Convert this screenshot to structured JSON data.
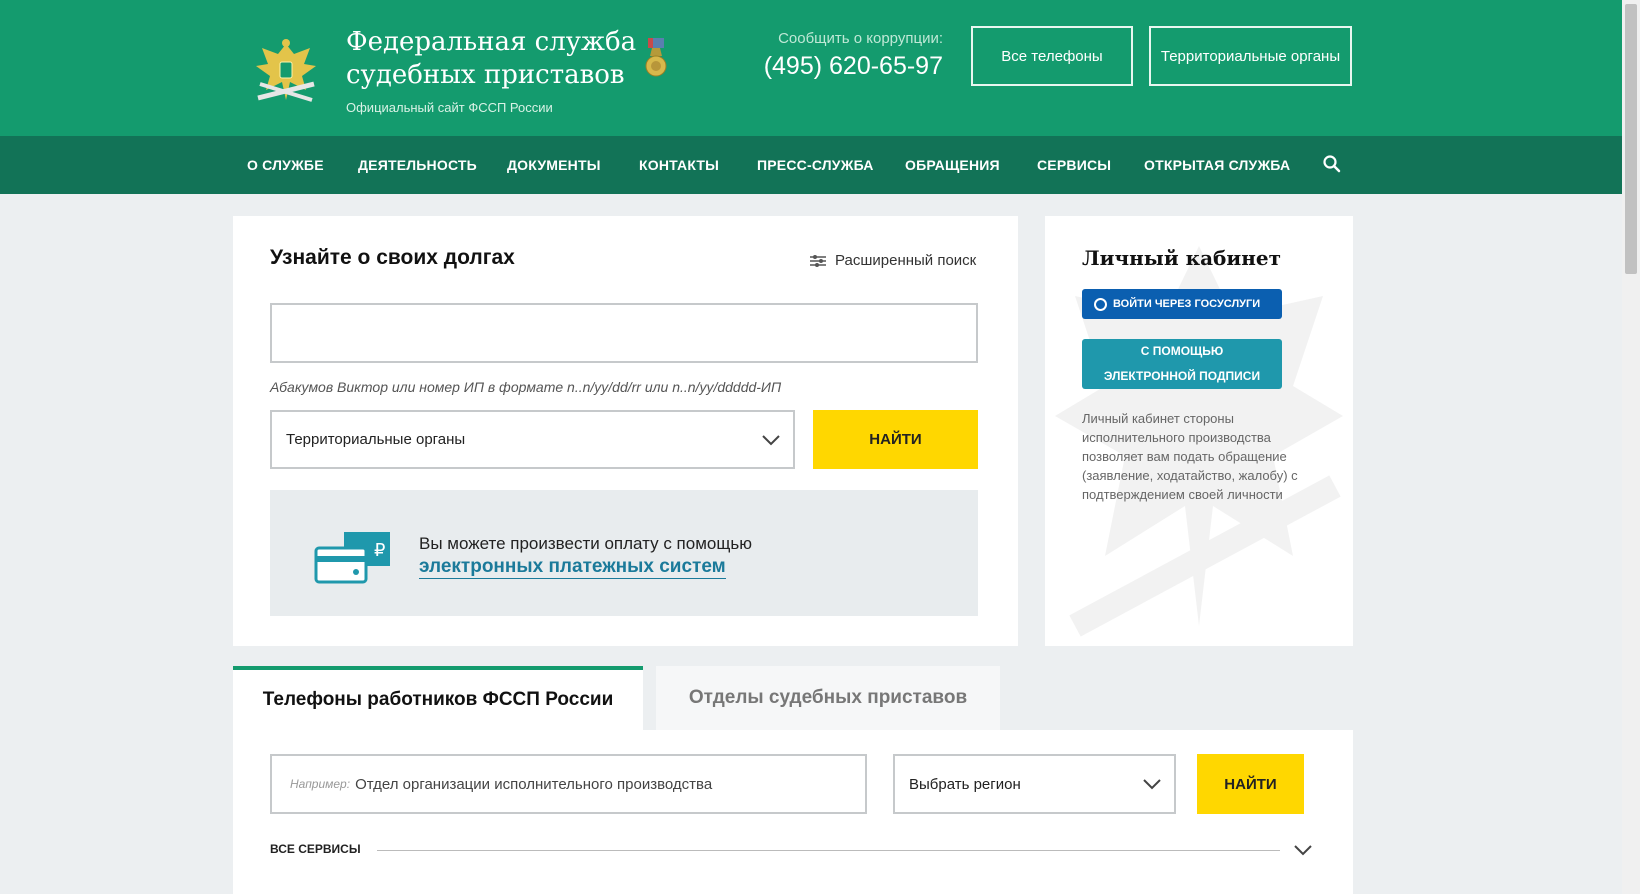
{
  "header": {
    "title_line1": "Федеральная служба",
    "title_line2": "судебных приставов",
    "subtitle": "Официальный сайт ФССП России",
    "corruption_label": "Сообщить о коррупции:",
    "corruption_phone": "(495) 620-65-97",
    "btn_all_phones": "Все телефоны",
    "btn_territorial": "Территориальные органы",
    "colors": {
      "header_bg": "#149b6e",
      "nav_bg": "#127357",
      "accent_yellow": "#ffd700"
    }
  },
  "nav": {
    "items": [
      "О СЛУЖБЕ",
      "ДЕЯТЕЛЬНОСТЬ",
      "ДОКУМЕНТЫ",
      "КОНТАКТЫ",
      "ПРЕСС-СЛУЖБА",
      "ОБРАЩЕНИЯ",
      "СЕРВИСЫ",
      "ОТКРЫТАЯ СЛУЖБА"
    ],
    "search_icon": "search-icon"
  },
  "debt": {
    "title": "Узнайте о своих долгах",
    "advanced_search": "Расширенный поиск",
    "input_value": "",
    "hint": "Абакумов Виктор или номер ИП в формате n..n/yy/dd/rr или n..n/yy/ddddd-ИП",
    "territorial_select": "Территориальные органы",
    "find_button": "НАЙТИ",
    "pay_text": "Вы можете произвести оплату с помощью",
    "pay_link": "электронных платежных систем"
  },
  "cabinet": {
    "title": "Личный кабинет",
    "gosuslugi_button": "ВОЙТИ ЧЕРЕЗ ГОСУСЛУГИ",
    "signature_line1": "С ПОМОЩЬЮ",
    "signature_line2": "ЭЛЕКТРОННОЙ ПОДПИСИ",
    "description": "Личный кабинет стороны исполнительного производства позволяет вам подать обращение (заявление, ходатайство, жалобу) с подтверждением своей личности"
  },
  "tabs": {
    "active": "Телефоны работников ФССП России",
    "inactive": "Отделы судебных приставов"
  },
  "phones": {
    "example_label": "Например:",
    "placeholder": "Отдел организации исполнительного производства",
    "region_select": "Выбрать регион",
    "find_button": "НАЙТИ",
    "all_services": "ВСЕ СЕРВИСЫ"
  }
}
